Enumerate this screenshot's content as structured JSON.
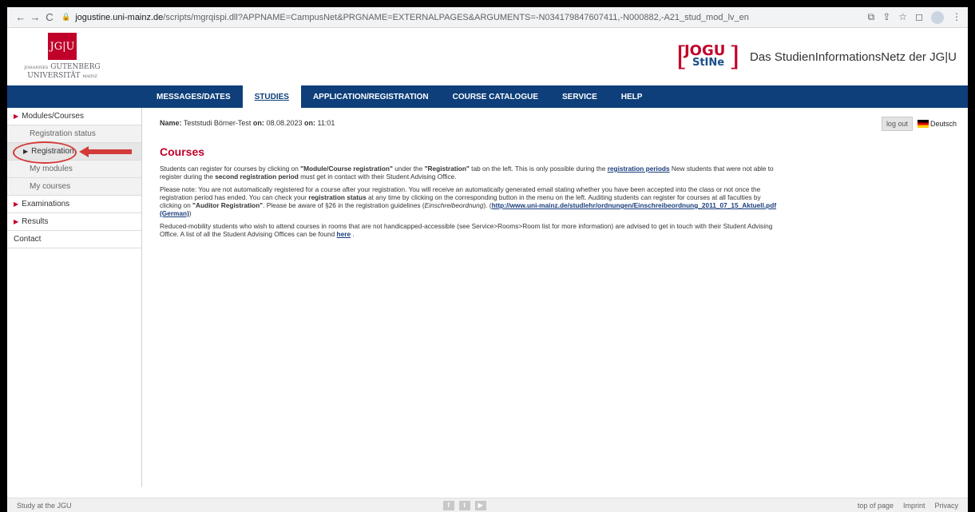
{
  "browser": {
    "url_domain": "jogustine.uni-mainz.de",
    "url_path": "/scripts/mgrqispi.dll?APPNAME=CampusNet&PRGNAME=EXTERNALPAGES&ARGUMENTS=-N034179847607411,-N000882,-A21_stud_mod_lv_en",
    "back_icon": "←",
    "forward_icon": "→",
    "reload_icon": "C"
  },
  "header": {
    "jgu_mark": "JG|U",
    "jgu_line1": "GUTENBERG",
    "jgu_prefix": "JOHANNES",
    "jgu_line2": "UNIVERSITÄT",
    "jgu_suffix": "MAINZ",
    "stine_jogu": "JOGU",
    "stine_name": "StINe",
    "slogan": "Das StudienInformationsNetz der JG|U"
  },
  "top_nav": [
    {
      "label": "MESSAGES/DATES"
    },
    {
      "label": "STUDIES"
    },
    {
      "label": "APPLICATION/REGISTRATION"
    },
    {
      "label": "COURSE CATALOGUE"
    },
    {
      "label": "SERVICE"
    },
    {
      "label": "HELP"
    }
  ],
  "sidebar": {
    "modules_courses": "Modules/Courses",
    "registration_status": "Registration status",
    "registration": "Registration",
    "my_modules": "My modules",
    "my_courses": "My courses",
    "examinations": "Examinations",
    "results": "Results",
    "contact": "Contact"
  },
  "user": {
    "name_label": "Name:",
    "name": "Teststudi Börner-Test",
    "on_label": "on:",
    "date": "08.08.2023",
    "time_label": "on:",
    "time": "11:01"
  },
  "actions": {
    "logout": "log out",
    "language": "Deutsch"
  },
  "content": {
    "title": "Courses",
    "p1_a": "Students can register for courses by clicking on ",
    "p1_b": "\"Module/Course registration\"",
    "p1_c": " under the ",
    "p1_d": "\"Registration\"",
    "p1_e": " tab on the left. This is only possible during the ",
    "p1_link": "registration periods",
    "p1_f": " New students that were not able to register during the ",
    "p1_g": "second registration period",
    "p1_h": " must get in contact with their Student Advising Office.",
    "p2_a": "Please note: You are not automatically registered for a course after your registration. You will receive an automatically generated email stating whether you have been accepted into the class or not once the registration period has ended. You can check your ",
    "p2_b": "registration status",
    "p2_c": " at any time by clicking on the corresponding button in the menu on the left. Auditing students can register for courses at all faculties by clicking on ",
    "p2_d": "\"Auditor Registration\"",
    "p2_e": ". Please be aware of §26 in the registration guidelines (",
    "p2_f": "Einschreibeordnung",
    "p2_g": "). (",
    "p2_link": "http://www.uni-mainz.de/studlehr/ordnungen/Einschreibeordnung_2011_07_15_Aktuell.pdf (German)",
    "p2_h": ")",
    "p3_a": "Reduced-mobility students who wish to attend courses in rooms that are not handicapped-accessible (see Service>Rooms>Room list for more information) are advised to get in touch with their Student Advising Office. A list of all the Student Advising Offices can be found ",
    "p3_link": "here",
    "p3_b": " ."
  },
  "footer": {
    "left": "Study at the JGU",
    "social_1": "f",
    "social_2": "t",
    "social_3": "▶",
    "top_of_page": "top of page",
    "imprint": "Imprint",
    "privacy": "Privacy"
  },
  "colors": {
    "brand_red": "#c1002a",
    "nav_blue": "#0e3f7a"
  }
}
